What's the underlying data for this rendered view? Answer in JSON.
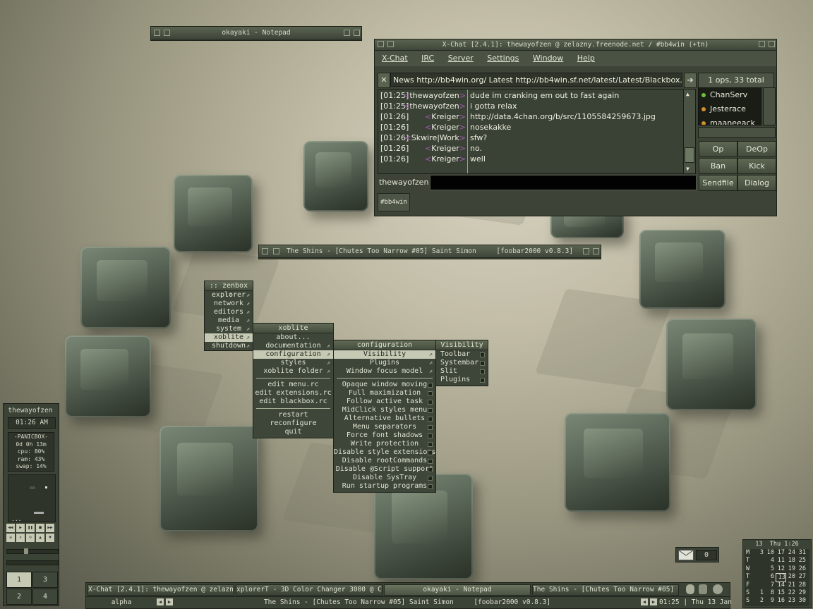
{
  "notepad": {
    "title": "okayaki - Notepad"
  },
  "xchat": {
    "title": "X-Chat [2.4.1]: thewayofzen @ zelazny.freenode.net / #bb4win (+tn)",
    "menu": [
      "X-Chat",
      "IRC",
      "Server",
      "Settings",
      "Window",
      "Help"
    ],
    "topic": "News http://bb4win.org/ Latest http://bb4win.sf.net/latest/Latest/Blackbox.zip",
    "ops_count": "1 ops, 33 total",
    "messages": [
      {
        "time": "[01:25]",
        "nick": "thewayofzen",
        "text": "dude im cranking em out to fast again"
      },
      {
        "time": "[01:25]",
        "nick": "thewayofzen",
        "text": "i gotta relax"
      },
      {
        "time": "[01:26]",
        "nick": "Kreiger",
        "text": "http://data.4chan.org/b/src/1105584259673.jpg"
      },
      {
        "time": "[01:26]",
        "nick": "Kreiger",
        "text": "nosekakke"
      },
      {
        "time": "[01:26]",
        "nick": "Skwire|Work",
        "text": "sfw?"
      },
      {
        "time": "[01:26]",
        "nick": "Kreiger",
        "text": "no."
      },
      {
        "time": "[01:26]",
        "nick": "Kreiger",
        "text": "well"
      }
    ],
    "users": [
      "ChanServ",
      "Jesterace",
      "maaneeack"
    ],
    "buttons": [
      "Op",
      "DeOp",
      "Ban",
      "Kick",
      "Sendfile",
      "Dialog"
    ],
    "nick": "thewayofzen",
    "channel_tab": "#bb4win"
  },
  "player": {
    "title": "The Shins - [Chutes Too Narrow #05] Saint Simon     [foobar2000 v0.8.3]"
  },
  "menus": {
    "root": {
      "title": ":: zenbox ::",
      "items": [
        "explorer",
        "network",
        "editors",
        "media",
        "system",
        "xoblite",
        "shutdown"
      ]
    },
    "xoblite": {
      "title": "xoblite",
      "items1": [
        "about...",
        "documentation",
        "configuration",
        "styles",
        "xoblite folder"
      ],
      "items2": [
        "edit menu.rc",
        "edit extensions.rc",
        "edit blackbox.rc"
      ],
      "items3": [
        "restart",
        "reconfigure",
        "quit"
      ]
    },
    "configuration": {
      "title": "configuration",
      "items1": [
        "Visibility",
        "Plugins",
        "Window focus model"
      ],
      "items2": [
        "Opaque window moving",
        "Full maximization",
        "Follow active task",
        "MidClick styles menu",
        "Alternative bullets",
        "Menu separators",
        "Force font shadows",
        "Write protection",
        "Disable style extensions",
        "Disable rootCommands",
        "Disable @Script support",
        "Disable SysTray",
        "Run startup programs"
      ]
    },
    "visibility": {
      "title": "Visibility",
      "items": [
        "Toolbar",
        "Systembar",
        "Slit",
        "Plugins"
      ]
    }
  },
  "slit": {
    "user": "thewayofzen",
    "clock": "01:26 AM",
    "sysinfo": [
      "-PANICBOX-",
      "0d 0h 13m",
      "cpu: 80%",
      "ram: 43%",
      "swap: 14%"
    ],
    "workspaces": [
      "1",
      "3",
      "2",
      "4"
    ],
    "mail_count": "0"
  },
  "taskbar": {
    "tasks": [
      "X-Chat [2.4.1]: thewayofzen @ zelazn...",
      "xplorerT - 3D Color Changer 3000 @ C...",
      "okayaki - Notepad",
      "The Shins - [Chutes Too Narrow #05] ..."
    ],
    "workspace": "alpha",
    "window_label": "The Shins - [Chutes Too Narrow #05] Saint Simon     [foobar2000 v0.8.3]",
    "clock": "01:25 | Thu 13 Jan"
  },
  "calendar": {
    "header": "13  Thu 1:26",
    "days": [
      "M",
      "T",
      "W",
      "T",
      "F",
      "S",
      "S"
    ],
    "rows": [
      [
        "3",
        "10",
        "17",
        "24",
        "31"
      ],
      [
        "4",
        "11",
        "18",
        "25"
      ],
      [
        "5",
        "12",
        "19",
        "26"
      ],
      [
        "6",
        "13",
        "20",
        "27"
      ],
      [
        "7",
        "14",
        "21",
        "28"
      ],
      [
        "1",
        "8",
        "15",
        "22",
        "29"
      ],
      [
        "2",
        "9",
        "16",
        "23",
        "30"
      ]
    ]
  }
}
